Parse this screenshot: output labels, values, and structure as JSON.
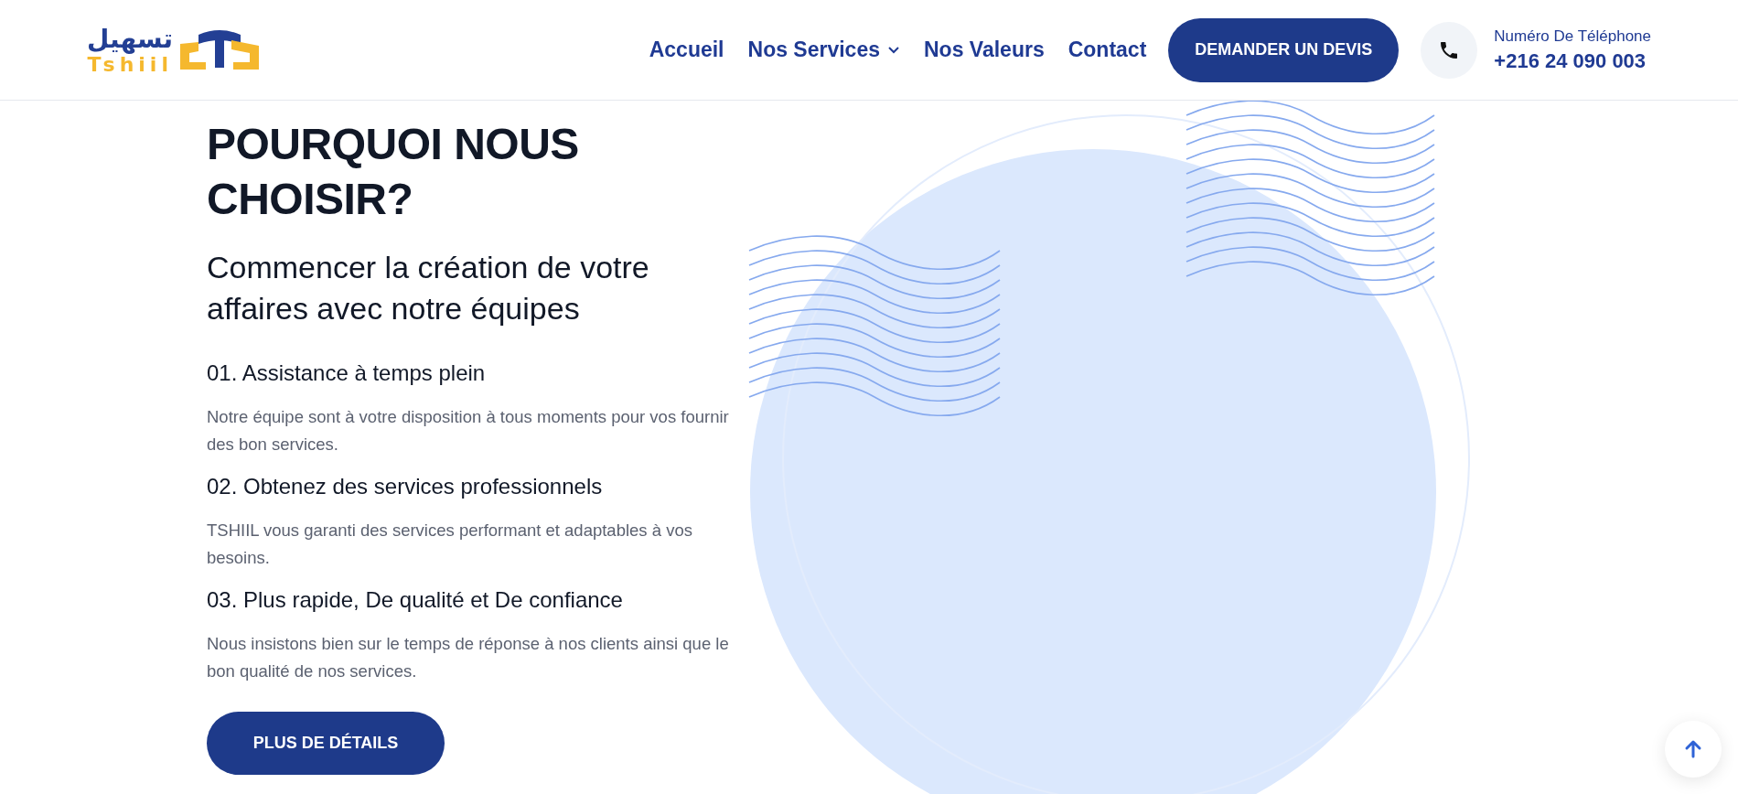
{
  "header": {
    "logo": {
      "arabic": "تسهيل",
      "latin": "Tshiil"
    },
    "nav": [
      {
        "label": "Accueil",
        "dropdown": false
      },
      {
        "label": "Nos Services",
        "dropdown": true
      },
      {
        "label": "Nos Valeurs",
        "dropdown": false
      },
      {
        "label": "Contact",
        "dropdown": false
      }
    ],
    "cta": "DEMANDER UN DEVIS",
    "phone": {
      "label": "Numéro De Téléphone",
      "number": "+216 24 090 003"
    }
  },
  "section": {
    "title": "POURQUOI NOUS CHOISIR?",
    "subtitle": "Commencer la création de votre affaires avec notre équipes",
    "features": [
      {
        "title": "01. Assistance à temps plein",
        "text": "Notre équipe sont à votre disposition à tous moments pour vos fournir des bon services."
      },
      {
        "title": "02. Obtenez des services professionnels",
        "text": "TSHIIL vous garanti des services performant et adaptables à vos besoins."
      },
      {
        "title": "03. Plus rapide, De qualité et De confiance",
        "text": "Nous insistons bien sur le temps de réponse à nos clients ainsi que le bon qualité de nos services."
      }
    ],
    "button": "PLUS DE DÉTAILS"
  }
}
